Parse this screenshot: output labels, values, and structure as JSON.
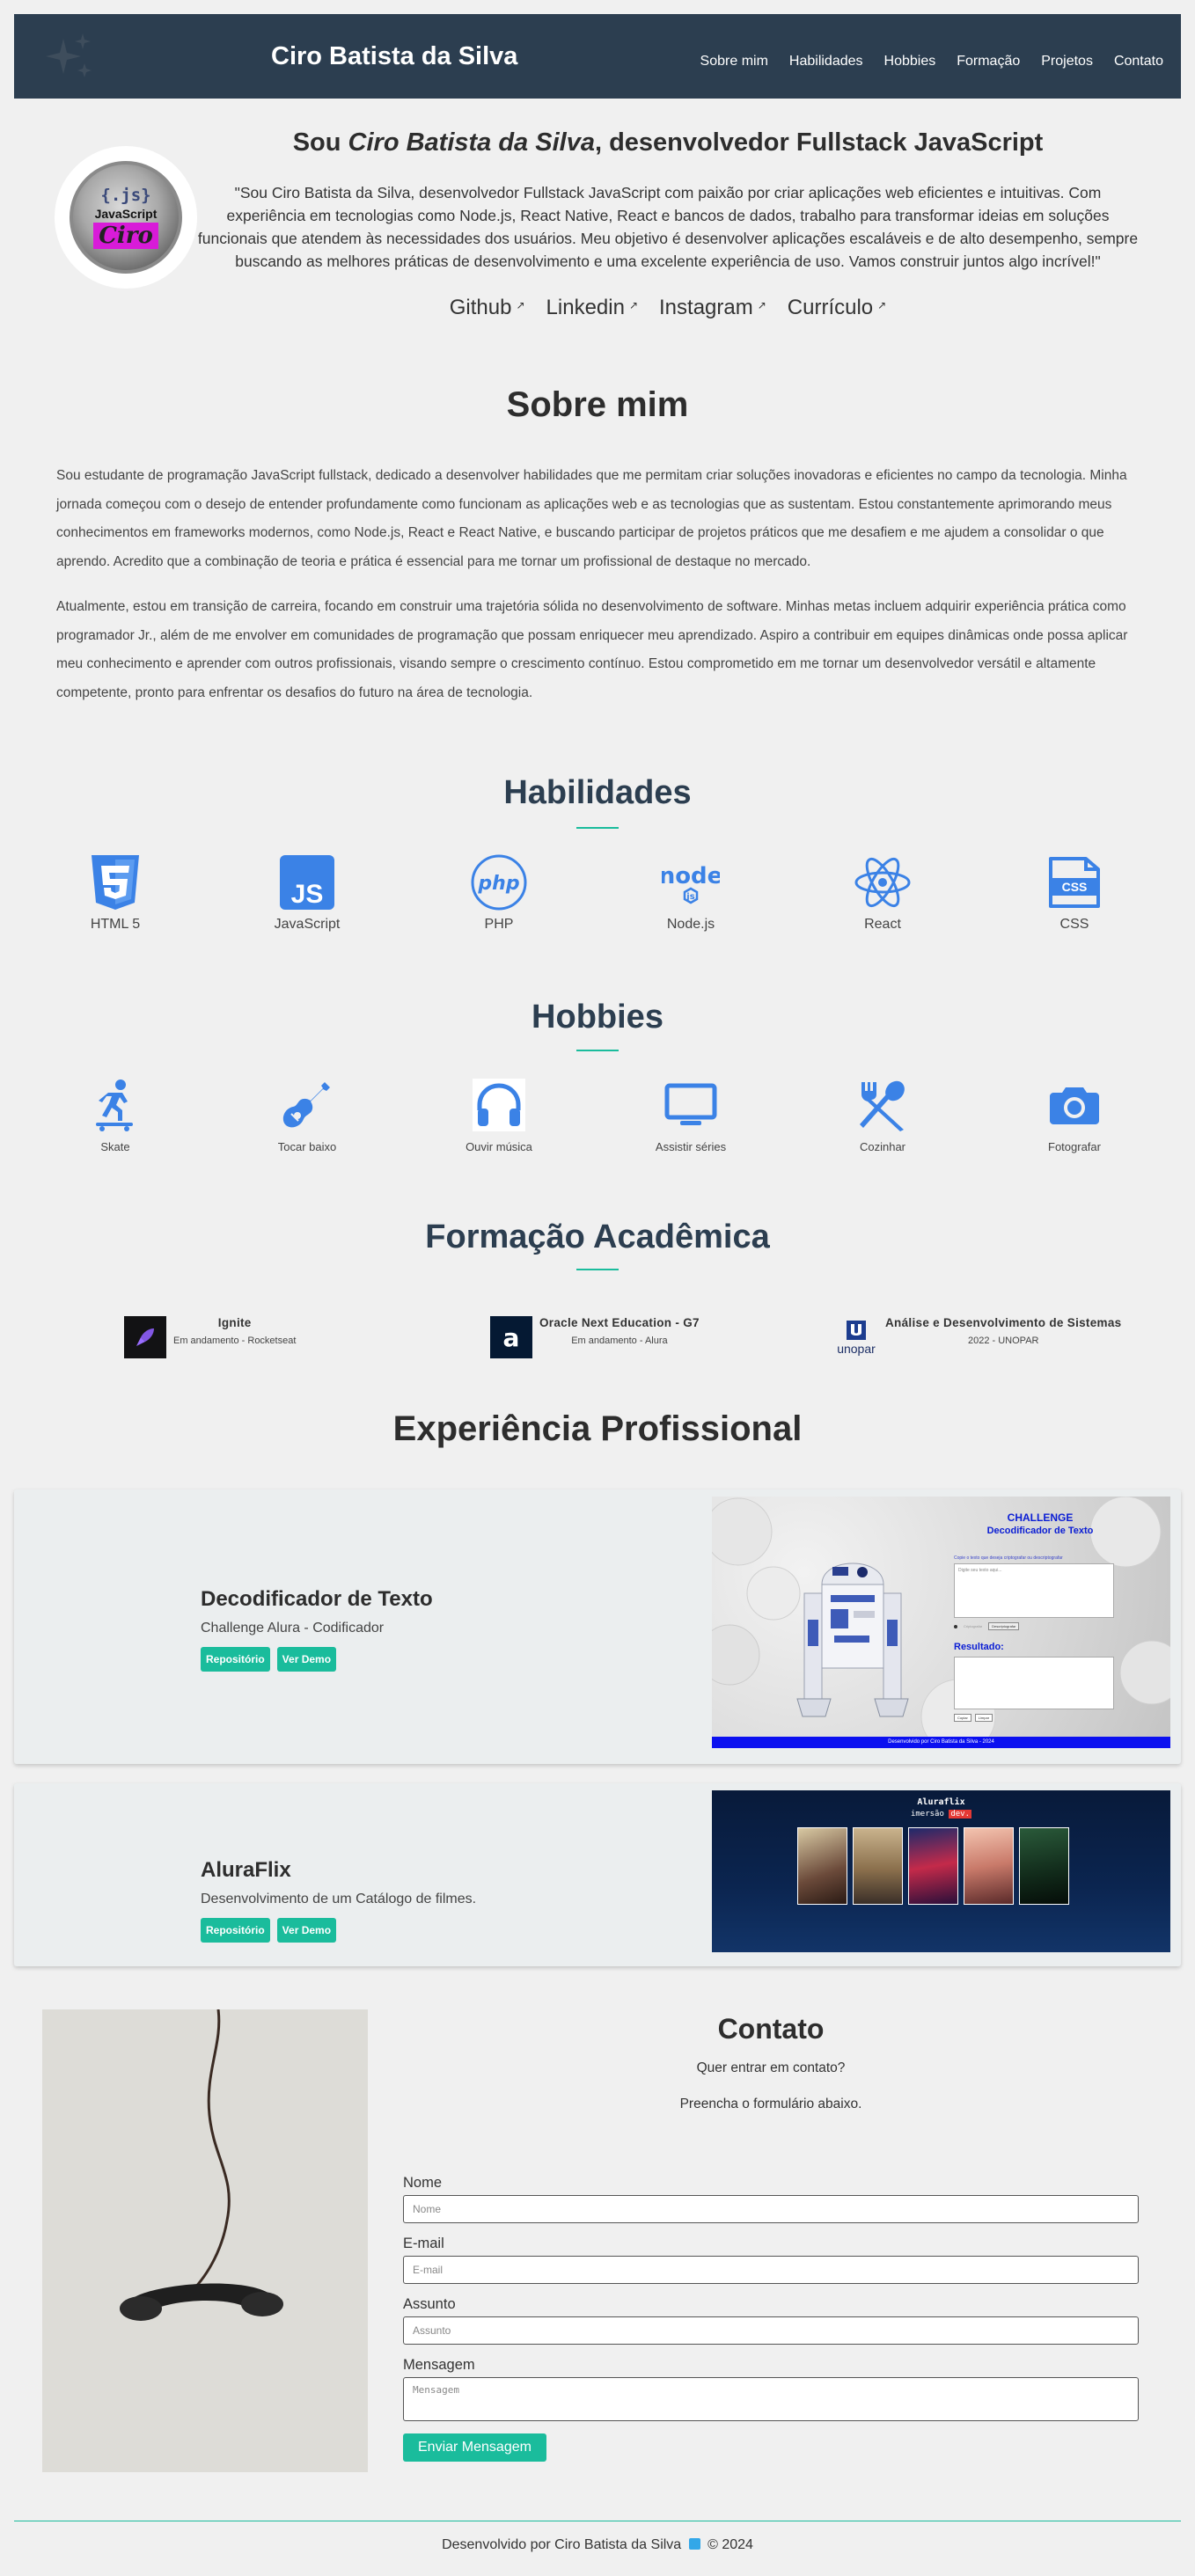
{
  "header": {
    "site_name": "Ciro Batista da Silva",
    "nav": [
      "Sobre mim",
      "Habilidades",
      "Hobbies",
      "Formação",
      "Projetos",
      "Contato"
    ]
  },
  "intro": {
    "avatar_text": {
      "top": "{.js}",
      "middle": "JavaScript",
      "signature": "Ciro"
    },
    "title_prefix": "Sou ",
    "title_name": "Ciro Batista da Silva",
    "title_suffix": ", desenvolvedor Fullstack JavaScript",
    "text": "\"Sou Ciro Batista da Silva, desenvolvedor Fullstack JavaScript com paixão por criar aplicações web eficientes e intuitivas. Com experiência em tecnologias como Node.js, React Native, React e bancos de dados, trabalho para transformar ideias em soluções funcionais que atendem às necessidades dos usuários. Meu objetivo é desenvolver aplicações escaláveis e de alto desempenho, sempre buscando as melhores práticas de desenvolvimento e uma excelente experiência de uso. Vamos construir juntos algo incrível!\"",
    "links": [
      "Github",
      "Linkedin",
      "Instagram",
      "Currículo"
    ]
  },
  "about": {
    "title": "Sobre mim",
    "p1": "Sou estudante de programação JavaScript fullstack, dedicado a desenvolver habilidades que me permitam criar soluções inovadoras e eficientes no campo da tecnologia. Minha jornada começou com o desejo de entender profundamente como funcionam as aplicações web e as tecnologias que as sustentam. Estou constantemente aprimorando meus conhecimentos em frameworks modernos, como Node.js, React e React Native, e buscando participar de projetos práticos que me desafiem e me ajudem a consolidar o que aprendo. Acredito que a combinação de teoria e prática é essencial para me tornar um profissional de destaque no mercado.",
    "p2": "Atualmente, estou em transição de carreira, focando em construir uma trajetória sólida no desenvolvimento de software. Minhas metas incluem adquirir experiência prática como programador Jr., além de me envolver em comunidades de programação que possam enriquecer meu aprendizado. Aspiro a contribuir em equipes dinâmicas onde possa aplicar meu conhecimento e aprender com outros profissionais, visando sempre o crescimento contínuo. Estou comprometido em me tornar um desenvolvedor versátil e altamente competente, pronto para enfrentar os desafios do futuro na área de tecnologia."
  },
  "skills": {
    "title": "Habilidades",
    "items": [
      {
        "label": "HTML 5",
        "icon": "html5-icon"
      },
      {
        "label": "JavaScript",
        "icon": "javascript-icon"
      },
      {
        "label": "PHP",
        "icon": "php-icon"
      },
      {
        "label": "Node.js",
        "icon": "nodejs-icon"
      },
      {
        "label": "React",
        "icon": "react-icon"
      },
      {
        "label": "CSS",
        "icon": "css-icon"
      }
    ]
  },
  "hobbies": {
    "title": "Hobbies",
    "items": [
      {
        "label": "Skate",
        "icon": "skateboarding-icon"
      },
      {
        "label": "Tocar baixo",
        "icon": "guitar-icon"
      },
      {
        "label": "Ouvir música",
        "icon": "headphones-icon"
      },
      {
        "label": "Assistir séries",
        "icon": "monitor-icon"
      },
      {
        "label": "Cozinhar",
        "icon": "utensils-icon"
      },
      {
        "label": "Fotografar",
        "icon": "camera-icon"
      }
    ]
  },
  "education": {
    "title": "Formação Acadêmica",
    "items": [
      {
        "title": "Ignite",
        "sub": "Em andamento - Rocketseat",
        "logo": "rocketseat-logo"
      },
      {
        "title": "Oracle Next Education - G7",
        "sub": "Em andamento - Alura",
        "logo": "alura-logo"
      },
      {
        "title": "Análise e Desenvolvimento de Sistemas",
        "sub": "2022 - UNOPAR",
        "logo": "unopar-logo",
        "logo_text": "unopar"
      }
    ]
  },
  "experience": {
    "title": "Experiência Profissional",
    "projects": [
      {
        "title": "Decodificador de Texto",
        "desc": "Challenge Alura - Codificador",
        "repo_label": "Repositório",
        "demo_label": "Ver Demo",
        "preview": {
          "heading": "CHALLENGE",
          "subheading": "Decodificador de Texto",
          "hint": "Copie o texto que deseja criptografar ou descriptografar",
          "placeholder": "Digite seu texto aqui...",
          "result_label": "Resultado:",
          "btn1": "Criptografar",
          "btn2": "Descriptografar",
          "btn3": "Copiar",
          "btn4": "Limpar",
          "footer": "Desenvolvido por Ciro Batista da Silva - 2024"
        }
      },
      {
        "title": "AluraFlix",
        "desc": "Desenvolvimento de um Catálogo de filmes.",
        "repo_label": "Repositório",
        "demo_label": "Ver Demo",
        "preview": {
          "heading": "Aluraflix",
          "sub_prefix": "imersão",
          "sub_badge": "dev."
        }
      }
    ]
  },
  "contact": {
    "title": "Contato",
    "line1": "Quer entrar em contato?",
    "line2": "Preencha o formulário abaixo.",
    "fields": [
      {
        "label": "Nome",
        "placeholder": "Nome"
      },
      {
        "label": "E-mail",
        "placeholder": "E-mail"
      },
      {
        "label": "Assunto",
        "placeholder": "Assunto"
      },
      {
        "label": "Mensagem",
        "placeholder": "Mensagem"
      }
    ],
    "submit": "Enviar Mensagem"
  },
  "footer": {
    "prefix": "Desenvolvido por Ciro Batista da Silva",
    "suffix": "© 2024"
  },
  "colors": {
    "header_bg": "#2c3e50",
    "accent": "#1abc9c",
    "icon_blue": "#3b82e6",
    "page_bg": "#f0f0f0"
  }
}
